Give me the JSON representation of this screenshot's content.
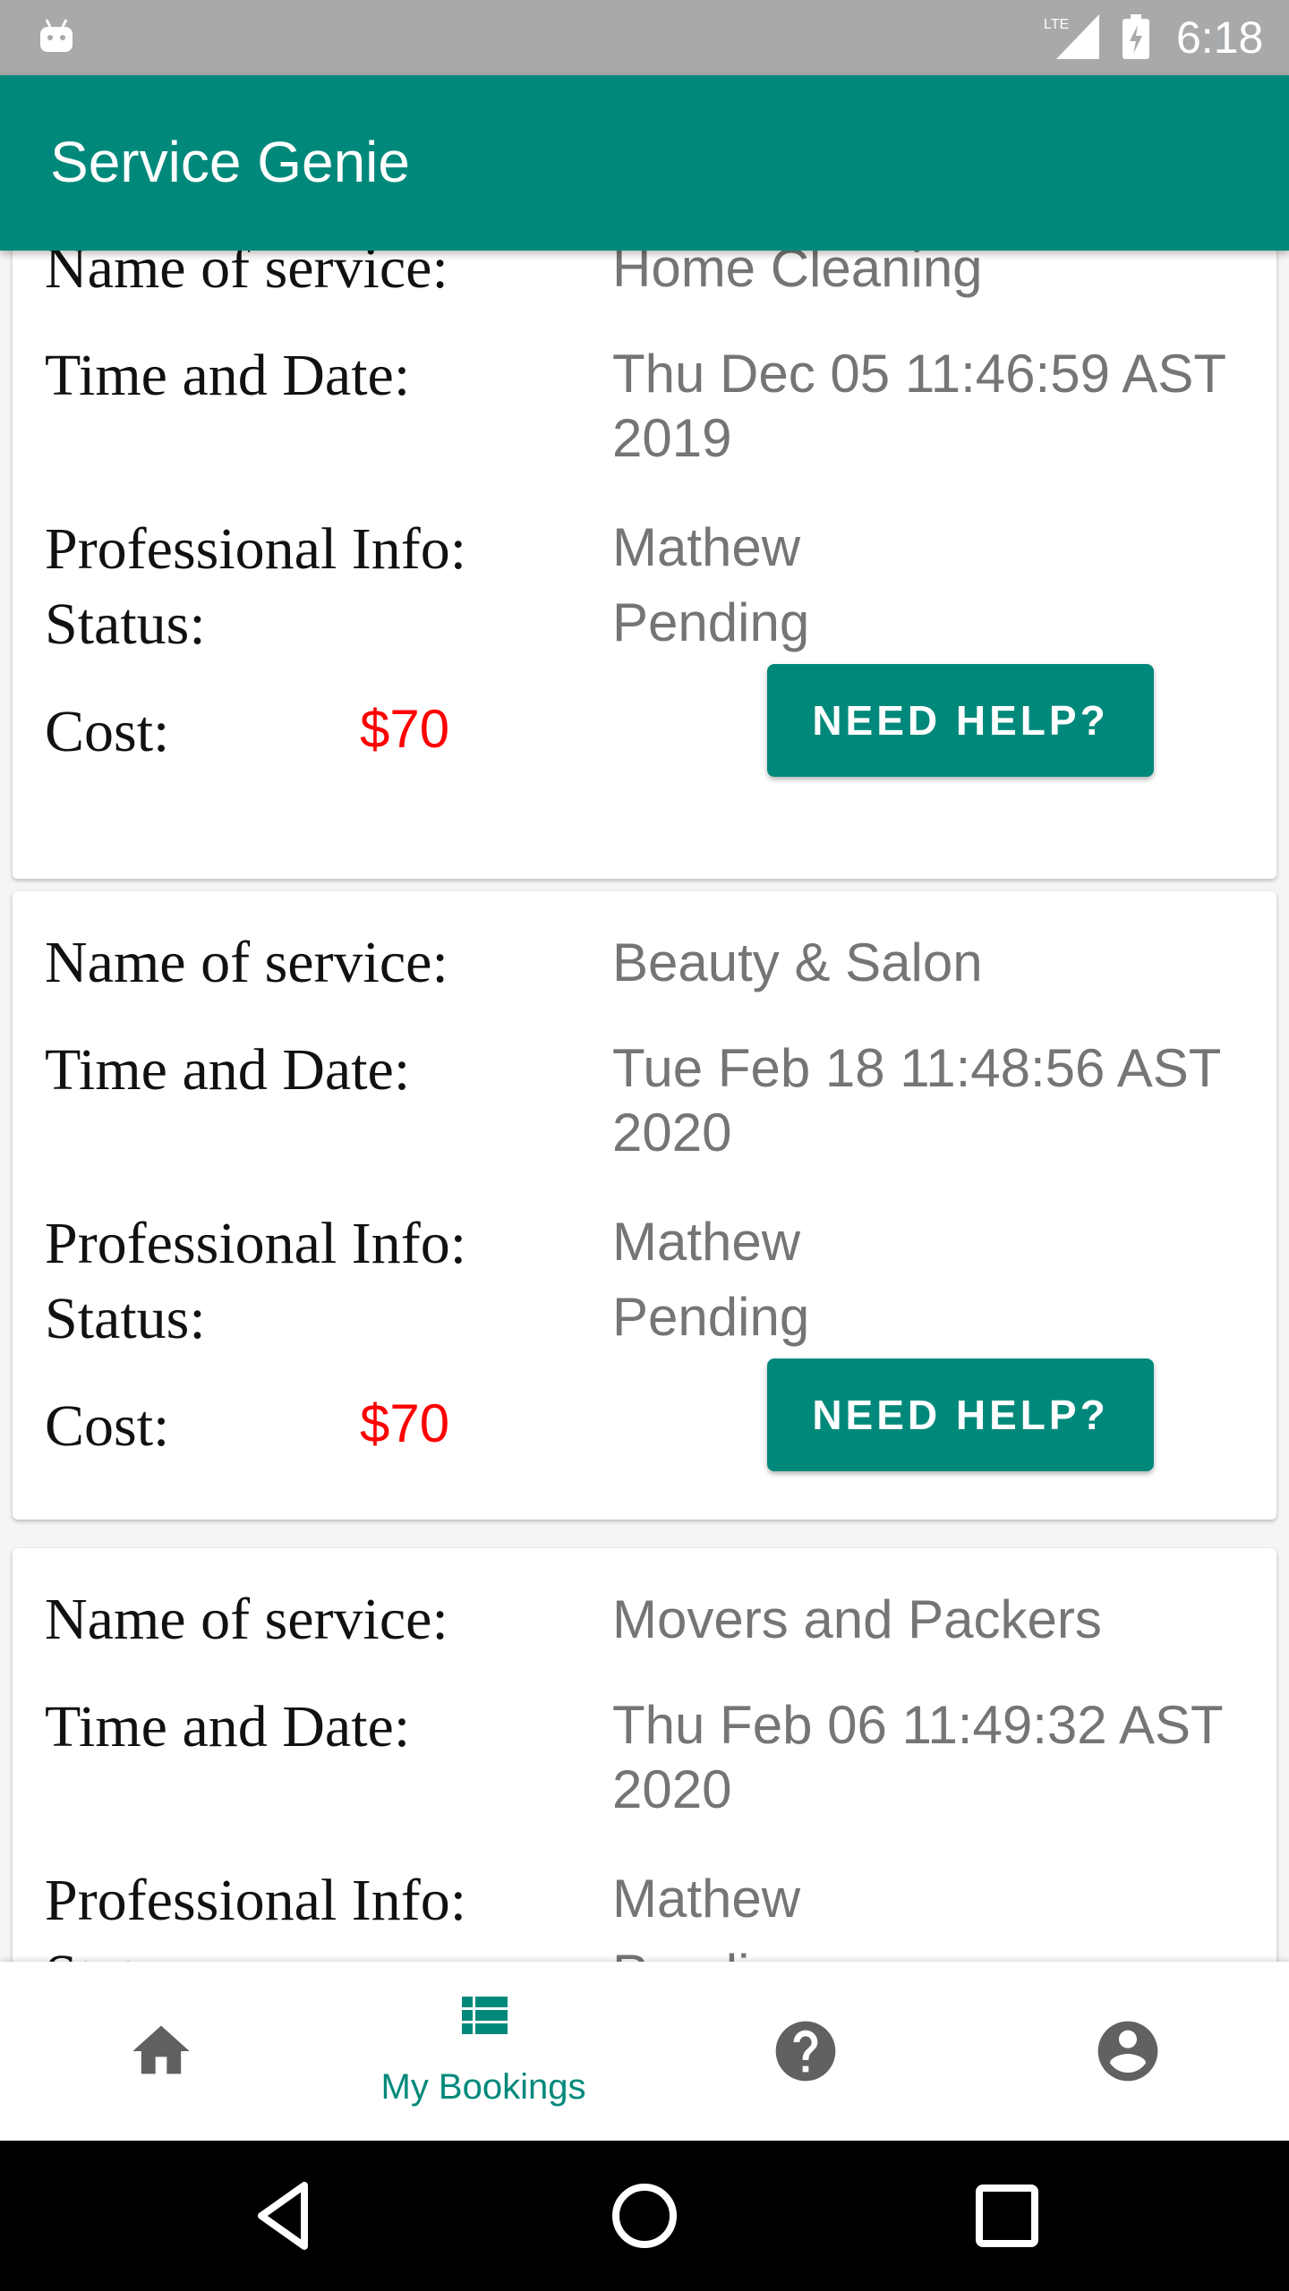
{
  "status_bar": {
    "time": "6:18",
    "network": "LTE"
  },
  "app_bar": {
    "title": "Service Genie"
  },
  "bookings": [
    {
      "service_label": "Name of service:",
      "service": "Home Cleaning",
      "time_label": "Time and Date:",
      "time": "Thu Dec 05 11:46:59 AST 2019",
      "professional_label": "Professional Info:",
      "professional": "Mathew",
      "status_label": "Status:",
      "status": "Pending",
      "cost_label": "Cost:",
      "cost": "$70",
      "help_button": "NEED HELP?"
    },
    {
      "service_label": "Name of service:",
      "service": "Beauty & Salon",
      "time_label": "Time and Date:",
      "time": "Tue Feb 18 11:48:56 AST 2020",
      "professional_label": "Professional Info:",
      "professional": "Mathew",
      "status_label": "Status:",
      "status": "Pending",
      "cost_label": "Cost:",
      "cost": "$70",
      "help_button": "NEED HELP?"
    },
    {
      "service_label": "Name of service:",
      "service": "Movers and Packers",
      "time_label": "Time and Date:",
      "time": "Thu Feb 06 11:49:32 AST 2020",
      "professional_label": "Professional Info:",
      "professional": "Mathew",
      "status_label": "Status:",
      "status": "Pending"
    }
  ],
  "bottom_nav": {
    "items": [
      {
        "icon": "home-icon",
        "label": ""
      },
      {
        "icon": "list-icon",
        "label": "My Bookings",
        "active": true
      },
      {
        "icon": "help-icon",
        "label": ""
      },
      {
        "icon": "account-icon",
        "label": ""
      }
    ]
  },
  "colors": {
    "primary": "#00897b",
    "cost": "#ff0000",
    "status_bar": "#a7a9ab"
  }
}
